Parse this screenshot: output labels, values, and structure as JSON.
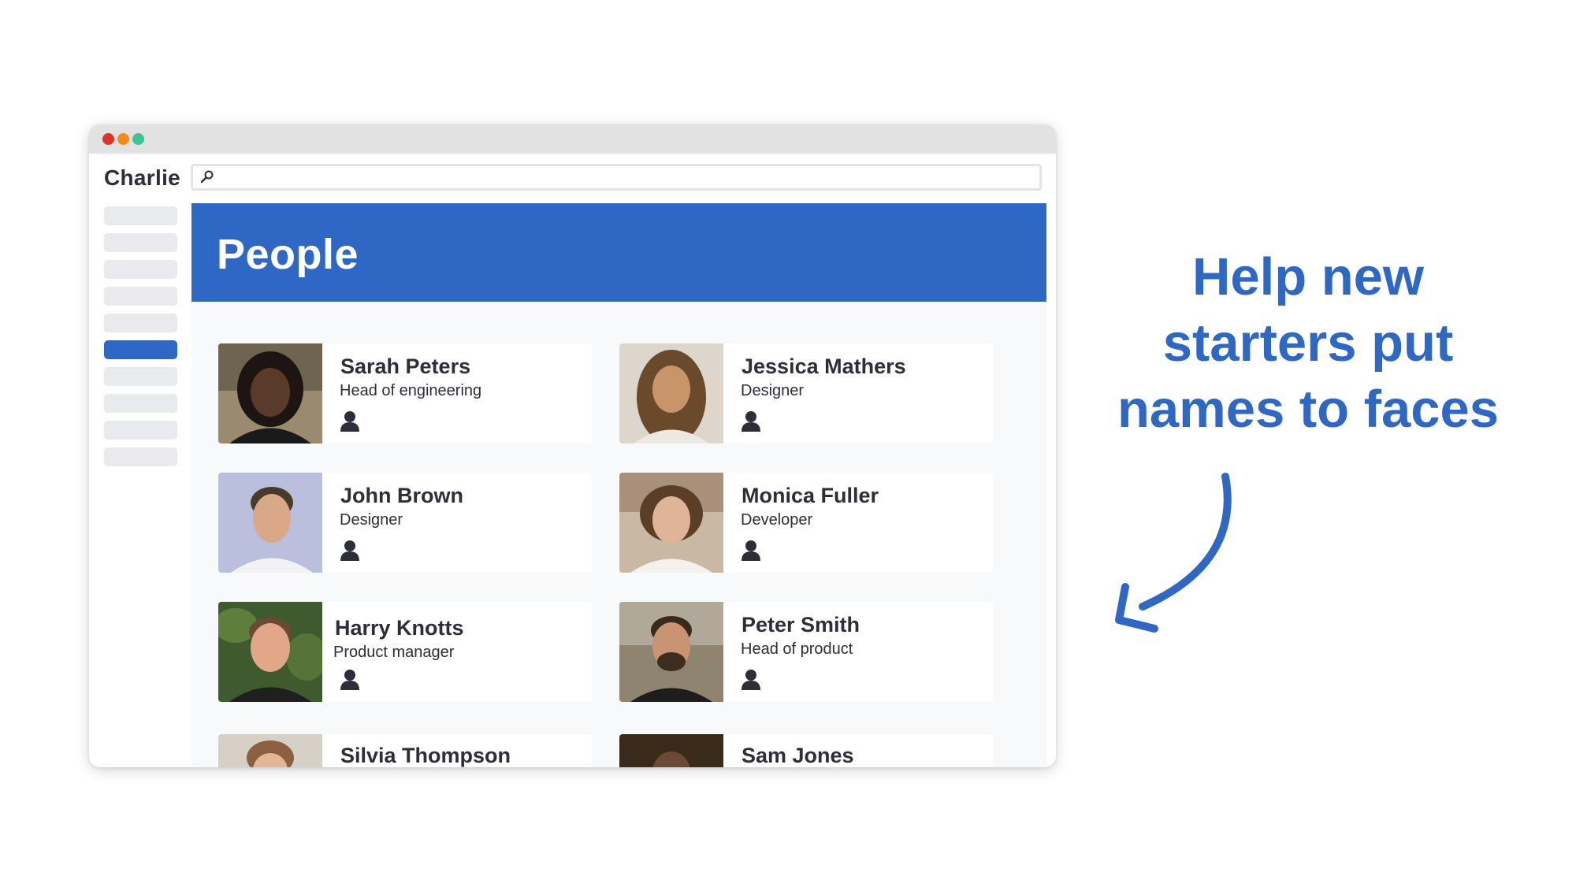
{
  "app": {
    "brand": "Charlie"
  },
  "search": {
    "value": "",
    "placeholder": ""
  },
  "sidebar": {
    "item_count": 10,
    "active_index": 5
  },
  "page": {
    "title": "People"
  },
  "people": [
    {
      "name": "Sarah Peters",
      "role": "Head of engineering"
    },
    {
      "name": "Jessica Mathers",
      "role": "Designer"
    },
    {
      "name": "John Brown",
      "role": "Designer"
    },
    {
      "name": "Monica Fuller",
      "role": "Developer"
    },
    {
      "name": "Harry Knotts",
      "role": "Product manager"
    },
    {
      "name": "Peter Smith",
      "role": "Head of product"
    },
    {
      "name": "Silvia Thompson",
      "role": ""
    },
    {
      "name": "Sam Jones",
      "role": ""
    }
  ],
  "tagline": {
    "line1": "Help new",
    "line2": "starters put",
    "line3": "names to faces"
  },
  "colors": {
    "accent": "#2e68c4",
    "text": "#2c2f3a",
    "sidebar_item": "#e8eaed",
    "dot_red": "#e0322b",
    "dot_orange": "#f28a1c",
    "dot_green": "#3cc494"
  },
  "icons": {
    "search": "search-icon",
    "profile": "person-icon",
    "arrow": "curved-arrow-icon"
  }
}
